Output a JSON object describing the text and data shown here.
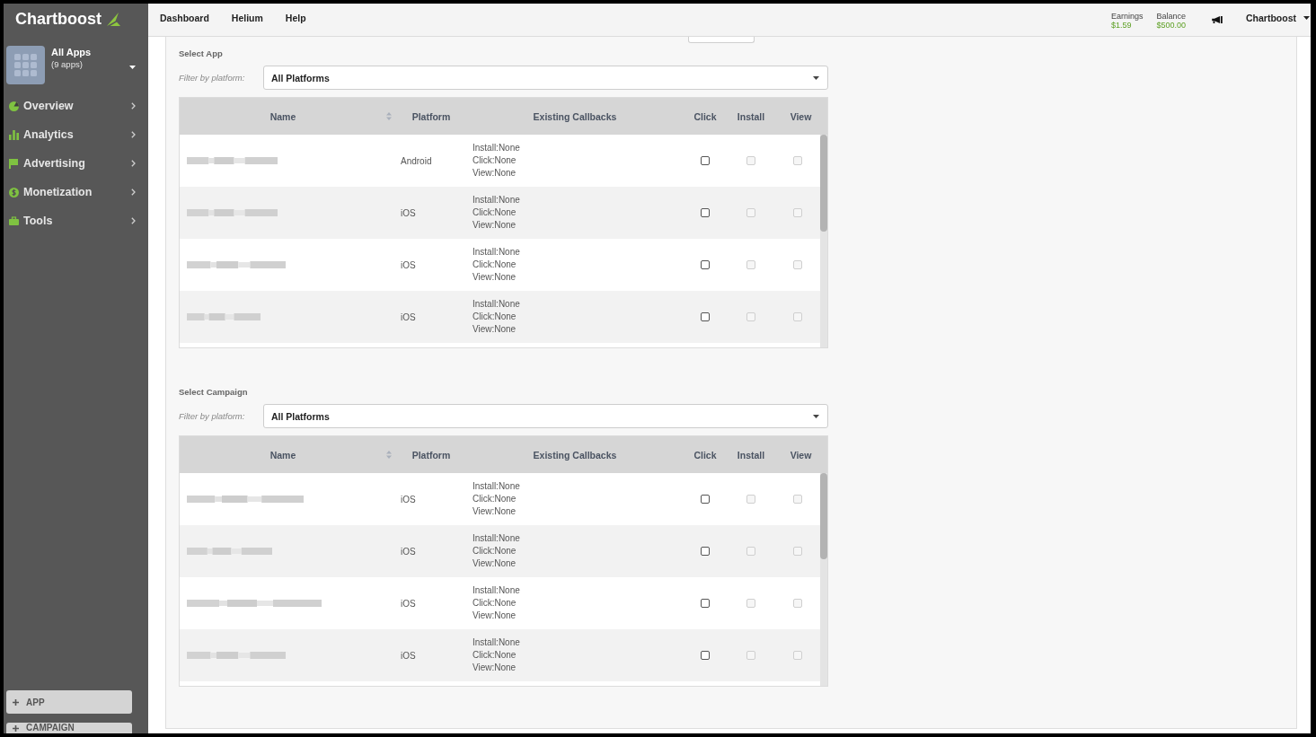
{
  "sidebar": {
    "logo": {
      "text": "Chartboost"
    },
    "app_switcher": {
      "title": "All Apps",
      "subtitle": "(9 apps)"
    },
    "items": [
      {
        "label": "Overview",
        "selected": false
      },
      {
        "label": "Analytics",
        "selected": false
      },
      {
        "label": "Advertising",
        "selected": false
      },
      {
        "label": "Monetization",
        "selected": false
      },
      {
        "label": "Tools",
        "selected": false
      }
    ],
    "buttons": [
      {
        "label": "APP"
      },
      {
        "label": "CAMPAIGN"
      }
    ]
  },
  "top_bar": {
    "menu": [
      {
        "label": "Dashboard",
        "selected": false
      },
      {
        "label": "Helium",
        "selected": false
      },
      {
        "label": "Help",
        "selected": false
      }
    ],
    "stats": [
      {
        "label": "Earnings",
        "value": "$1.59"
      },
      {
        "label": "Balance",
        "value": "$500.00"
      }
    ],
    "account": {
      "name": "Chartboost"
    }
  },
  "sections": [
    {
      "title": "Select App",
      "filter": {
        "label": "Filter by platform:",
        "value": "All Platforms"
      },
      "table": {
        "columns": [
          {
            "label": "Name",
            "sortable": true
          },
          {
            "label": "Platform",
            "sortable": false
          },
          {
            "label": "Existing Callbacks",
            "sortable": false
          },
          {
            "label": "Click",
            "sortable": false
          },
          {
            "label": "Install",
            "sortable": false
          },
          {
            "label": "View",
            "sortable": false
          }
        ],
        "rows": [
          {
            "platform": "Android",
            "callbacks": [
              "Install:None",
              "Click:None",
              "View:None"
            ],
            "checkboxes": [
              {
                "checked": false,
                "disabled": false
              },
              {
                "checked": false,
                "disabled": true
              },
              {
                "checked": false,
                "disabled": true
              }
            ]
          },
          {
            "platform": "iOS",
            "callbacks": [
              "Install:None",
              "Click:None",
              "View:None"
            ],
            "checkboxes": [
              {
                "checked": false,
                "disabled": false
              },
              {
                "checked": false,
                "disabled": true
              },
              {
                "checked": false,
                "disabled": true
              }
            ]
          },
          {
            "platform": "iOS",
            "callbacks": [
              "Install:None",
              "Click:None",
              "View:None"
            ],
            "checkboxes": [
              {
                "checked": false,
                "disabled": false
              },
              {
                "checked": false,
                "disabled": true
              },
              {
                "checked": false,
                "disabled": true
              }
            ]
          },
          {
            "platform": "iOS",
            "callbacks": [
              "Install:None",
              "Click:None",
              "View:None"
            ],
            "checkboxes": [
              {
                "checked": false,
                "disabled": false
              },
              {
                "checked": false,
                "disabled": true
              },
              {
                "checked": false,
                "disabled": true
              }
            ]
          }
        ]
      }
    },
    {
      "title": "Select Campaign",
      "filter": {
        "label": "Filter by platform:",
        "value": "All Platforms"
      },
      "table": {
        "columns": [
          {
            "label": "Name",
            "sortable": true
          },
          {
            "label": "Platform",
            "sortable": false
          },
          {
            "label": "Existing Callbacks",
            "sortable": false
          },
          {
            "label": "Click",
            "sortable": false
          },
          {
            "label": "Install",
            "sortable": false
          },
          {
            "label": "View",
            "sortable": false
          }
        ],
        "rows": [
          {
            "platform": "iOS",
            "callbacks": [
              "Install:None",
              "Click:None",
              "View:None"
            ],
            "checkboxes": [
              {
                "checked": false,
                "disabled": false
              },
              {
                "checked": false,
                "disabled": true
              },
              {
                "checked": false,
                "disabled": true
              }
            ]
          },
          {
            "platform": "iOS",
            "callbacks": [
              "Install:None",
              "Click:None",
              "View:None"
            ],
            "checkboxes": [
              {
                "checked": false,
                "disabled": false
              },
              {
                "checked": false,
                "disabled": true
              },
              {
                "checked": false,
                "disabled": true
              }
            ]
          },
          {
            "platform": "iOS",
            "callbacks": [
              "Install:None",
              "Click:None",
              "View:None"
            ],
            "checkboxes": [
              {
                "checked": false,
                "disabled": false
              },
              {
                "checked": false,
                "disabled": true
              },
              {
                "checked": false,
                "disabled": true
              }
            ]
          },
          {
            "platform": "iOS",
            "callbacks": [
              "Install:None",
              "Click:None",
              "View:None"
            ],
            "checkboxes": [
              {
                "checked": false,
                "disabled": false
              },
              {
                "checked": false,
                "disabled": true
              },
              {
                "checked": false,
                "disabled": true
              }
            ]
          }
        ]
      }
    }
  ]
}
